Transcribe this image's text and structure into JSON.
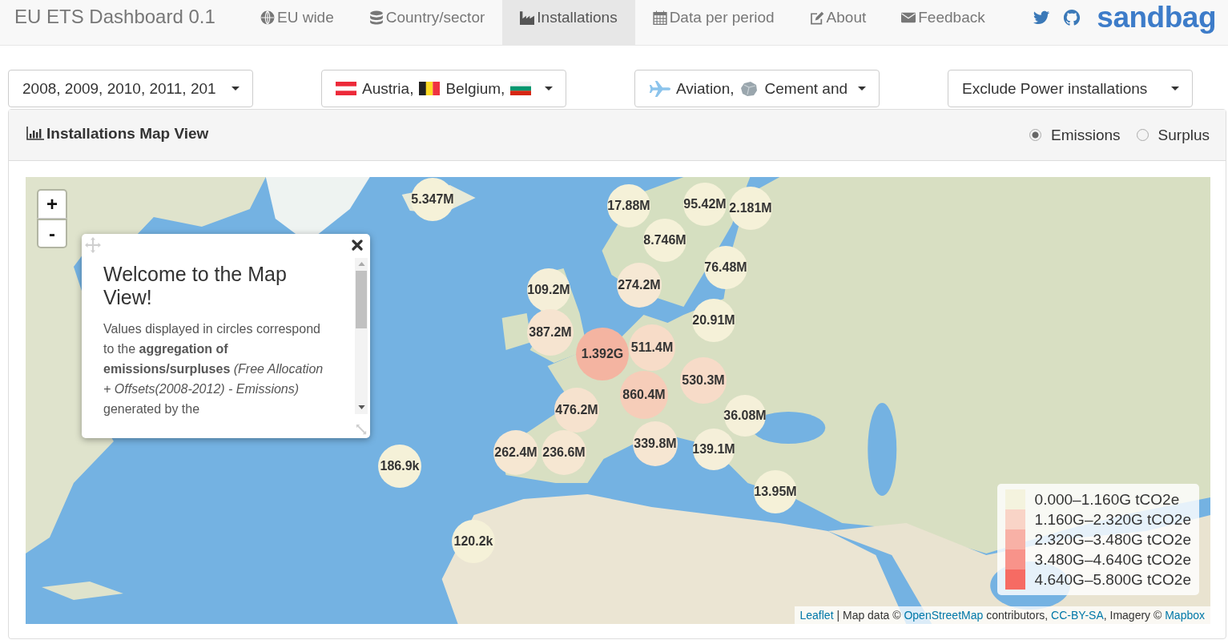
{
  "navbar": {
    "brand": "EU ETS Dashboard 0.1",
    "items": [
      {
        "label": "EU wide",
        "selected": false
      },
      {
        "label": "Country/sector",
        "selected": false
      },
      {
        "label": "Installations",
        "selected": true
      },
      {
        "label": "Data per period",
        "selected": false
      },
      {
        "label": "About",
        "selected": false
      },
      {
        "label": "Feedback",
        "selected": false
      }
    ],
    "logo": "sandbag"
  },
  "filters": [
    {
      "kind": "text",
      "label": "2008, 2009, 2010, 2011, 201"
    },
    {
      "kind": "flags",
      "items": [
        {
          "kind": "labelled",
          "label": "Austria,"
        },
        {
          "kind": "labelled",
          "label": "Belgium,"
        },
        {
          "kind": "icon_only"
        }
      ]
    },
    {
      "kind": "sectors",
      "items": [
        {
          "kind": "labelled",
          "label": "Aviation,"
        },
        {
          "kind": "labelled",
          "label": "Cement and"
        }
      ]
    },
    {
      "kind": "text",
      "label": "Exclude Power installations"
    }
  ],
  "panel": {
    "title": "Installations Map View",
    "options": [
      {
        "label": "Emissions",
        "selected": true
      },
      {
        "label": "Surplus",
        "selected": false
      }
    ],
    "map": {
      "zoom_controls": [
        "+",
        "-"
      ],
      "popup": {
        "title": "Welcome to the Map View!",
        "body": "Values displayed in circles correspond to the **aggregation of emissions/surpluses** *(Free Allocation + Offsets(2008-2012) - Emissions)* generated by the"
      },
      "markers": [
        {
          "label": "5.347M",
          "color": "#f5f1d8"
        },
        {
          "label": "17.88M",
          "color": "#f5f1d8"
        },
        {
          "label": "95.42M",
          "color": "#f5f1d8"
        },
        {
          "label": "2.181M",
          "color": "#f5f1d8"
        },
        {
          "label": "8.746M",
          "color": "#f5f1d8"
        },
        {
          "label": "76.48M",
          "color": "#f5f1d8"
        },
        {
          "label": "109.2M",
          "color": "#f5efd8"
        },
        {
          "label": "274.2M",
          "color": "#f6e8d4"
        },
        {
          "label": "20.91M",
          "color": "#f5f1d8"
        },
        {
          "label": "387.2M",
          "color": "#f6e4d0"
        },
        {
          "label": "1.392G",
          "color": "#f4b4a1"
        },
        {
          "label": "511.4M",
          "color": "#f7dcc8"
        },
        {
          "label": "530.3M",
          "color": "#f7dbc8"
        },
        {
          "label": "860.4M",
          "color": "#f6cdb9"
        },
        {
          "label": "476.2M",
          "color": "#f6e2ce"
        },
        {
          "label": "262.4M",
          "color": "#f6e7d2"
        },
        {
          "label": "236.6M",
          "color": "#f6e7d2"
        },
        {
          "label": "339.8M",
          "color": "#f6e6d2"
        },
        {
          "label": "36.08M",
          "color": "#f5f0d9"
        },
        {
          "label": "139.1M",
          "color": "#f5efd9"
        },
        {
          "label": "186.9k",
          "color": "#f5f1d8"
        },
        {
          "label": "13.95M",
          "color": "#f5f1d8"
        },
        {
          "label": "120.2k",
          "color": "#f5f1d8"
        }
      ],
      "legend": [
        {
          "label": "0.000–1.160G tCO2e",
          "color": "#f4f3de"
        },
        {
          "label": "1.160G–2.320G tCO2e",
          "color": "#f9d4c7"
        },
        {
          "label": "2.320G–3.480G tCO2e",
          "color": "#f8b1a6"
        },
        {
          "label": "3.480G–4.640G tCO2e",
          "color": "#f8938a"
        },
        {
          "label": "4.640G–5.800G tCO2e",
          "color": "#f66b63"
        }
      ],
      "attribution": [
        {
          "kind": "link",
          "text": "Leaflet"
        },
        {
          "kind": "plain",
          "text": " | Map data © "
        },
        {
          "kind": "link",
          "text": "OpenStreetMap"
        },
        {
          "kind": "plain",
          "text": " contributors, "
        },
        {
          "kind": "link",
          "text": "CC-BY-SA"
        },
        {
          "kind": "plain",
          "text": ", Imagery © "
        },
        {
          "kind": "link",
          "text": "Mapbox"
        }
      ]
    }
  }
}
